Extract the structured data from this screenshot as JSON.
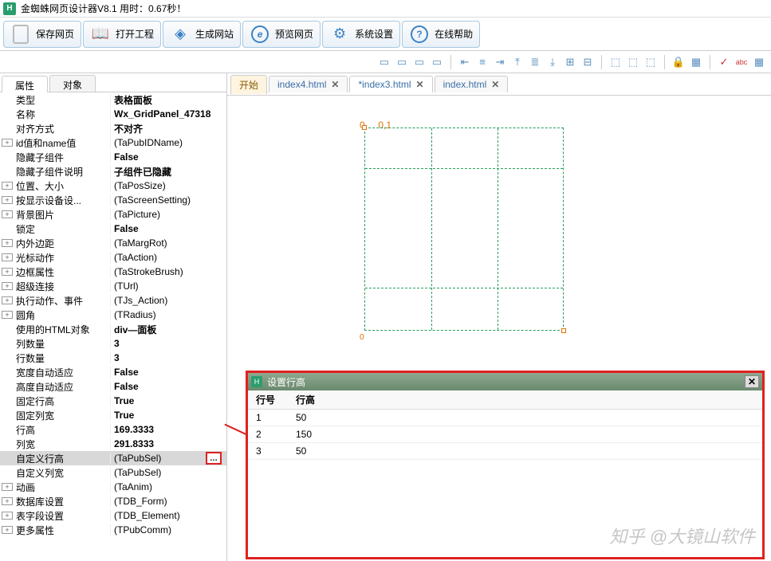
{
  "app": {
    "title": "金蜘蛛网页设计器V8.1  用时：0.67秒！",
    "icon": "H"
  },
  "toolbar": {
    "save": "保存网页",
    "open": "打开工程",
    "build": "生成网站",
    "preview": "预览网页",
    "settings": "系统设置",
    "help": "在线帮助"
  },
  "leftTabs": {
    "attr": "属性",
    "obj": "对象"
  },
  "props": [
    {
      "name": "类型",
      "val": "表格面板",
      "bold": true
    },
    {
      "name": "名称",
      "val": "Wx_GridPanel_47318",
      "bold": true
    },
    {
      "name": "对齐方式",
      "val": "不对齐",
      "bold": true
    },
    {
      "exp": "+",
      "name": "id值和name值",
      "val": "(TaPubIDName)"
    },
    {
      "name": "隐藏子组件",
      "val": "False",
      "bold": true
    },
    {
      "name": "隐藏子组件说明",
      "val": "子组件已隐藏",
      "bold": true
    },
    {
      "exp": "+",
      "name": "位置、大小",
      "val": "(TaPosSize)"
    },
    {
      "exp": "+",
      "name": "按显示设备设...",
      "val": "(TaScreenSetting)"
    },
    {
      "exp": "+",
      "name": "背景图片",
      "val": "(TaPicture)"
    },
    {
      "name": "锁定",
      "val": "False",
      "bold": true
    },
    {
      "exp": "+",
      "name": "内外边距",
      "val": "(TaMargRot)"
    },
    {
      "exp": "+",
      "name": "光标动作",
      "val": "(TaAction)"
    },
    {
      "exp": "+",
      "name": "边框属性",
      "val": "(TaStrokeBrush)"
    },
    {
      "exp": "+",
      "name": "超级连接",
      "val": "(TUrl)"
    },
    {
      "exp": "+",
      "name": "执行动作、事件",
      "val": "(TJs_Action)"
    },
    {
      "exp": "+",
      "name": "圆角",
      "val": "(TRadius)"
    },
    {
      "name": "使用的HTML对象",
      "val": "div—面板",
      "bold": true
    },
    {
      "name": "列数量",
      "val": "3",
      "bold": true
    },
    {
      "name": "行数量",
      "val": "3",
      "bold": true
    },
    {
      "name": "宽度自动适应",
      "val": "False",
      "bold": true
    },
    {
      "name": "高度自动适应",
      "val": "False",
      "bold": true
    },
    {
      "name": "固定行高",
      "val": "True",
      "bold": true
    },
    {
      "name": "固定列宽",
      "val": "True",
      "bold": true
    },
    {
      "name": "行高",
      "val": "169.3333",
      "bold": true
    },
    {
      "name": "列宽",
      "val": "291.8333",
      "bold": true
    },
    {
      "name": "自定义行高",
      "val": "(TaPubSel)",
      "sel": true,
      "btn": true
    },
    {
      "name": "自定义列宽",
      "val": "(TaPubSel)"
    },
    {
      "exp": "+",
      "name": "动画",
      "val": "(TaAnim)"
    },
    {
      "exp": "+",
      "name": "数据库设置",
      "val": "(TDB_Form)"
    },
    {
      "exp": "+",
      "name": "表字段设置",
      "val": "(TDB_Element)"
    },
    {
      "exp": "+",
      "name": "更多属性",
      "val": "(TPubComm)"
    }
  ],
  "fileTabs": {
    "start": "开始",
    "tabs": [
      {
        "label": "index4.html"
      },
      {
        "label": "*index3.html",
        "active": true
      },
      {
        "label": "index.html"
      }
    ]
  },
  "ruler": {
    "origin": "0",
    "coord": "0,1",
    "bot": "0"
  },
  "dialog": {
    "title": "设置行高",
    "col1": "行号",
    "col2": "行高",
    "rows": [
      {
        "n": "1",
        "h": "50"
      },
      {
        "n": "2",
        "h": "150"
      },
      {
        "n": "3",
        "h": "50"
      }
    ]
  },
  "watermark": "知乎 @大镜山软件"
}
